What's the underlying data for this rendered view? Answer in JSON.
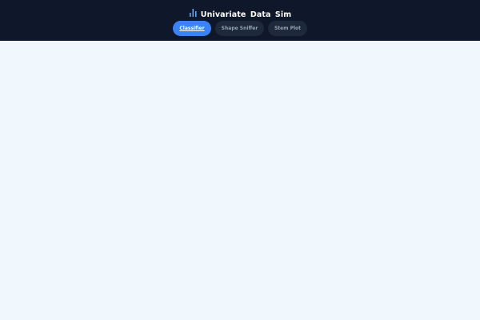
{
  "app": {
    "title": "Univariate Data Sim",
    "icon": "bar-chart-icon"
  },
  "tabs": [
    {
      "label": "Classifier",
      "active": true
    },
    {
      "label": "Shape Sniffer",
      "active": false
    },
    {
      "label": "Stem Plot",
      "active": false
    }
  ],
  "colors": {
    "header_bg": "#0f172a",
    "active_tab": "#3b82f6",
    "inactive_tab": "#1e293b",
    "inactive_text": "#94a3b8",
    "page_bg": "#f0f7fd"
  }
}
